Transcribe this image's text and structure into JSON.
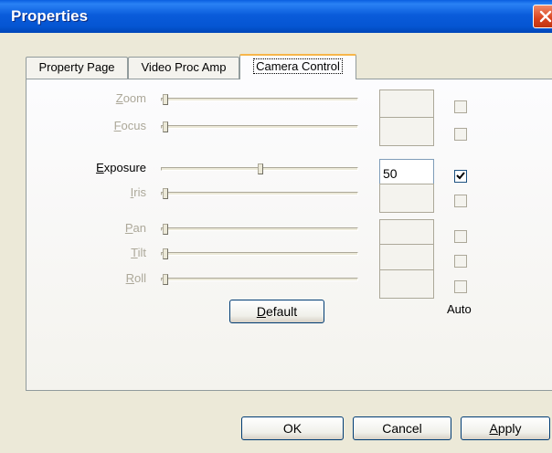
{
  "window": {
    "title": "Properties"
  },
  "tabs": [
    {
      "label": "Property Page",
      "active": false
    },
    {
      "label": "Video Proc Amp",
      "active": false
    },
    {
      "label": "Camera Control",
      "active": true
    }
  ],
  "controls": [
    {
      "label_first": "Z",
      "label_rest": "oom",
      "enabled": false,
      "value": "",
      "level": 0.0,
      "auto": false
    },
    {
      "label_first": "F",
      "label_rest": "ocus",
      "enabled": false,
      "value": "",
      "level": 0.0,
      "auto": false
    },
    {
      "label_first": "E",
      "label_rest": "xposure",
      "enabled": true,
      "value": "50",
      "level": 0.5,
      "auto": true
    },
    {
      "label_first": "I",
      "label_rest": "ris",
      "enabled": false,
      "value": "",
      "level": 0.0,
      "auto": false
    },
    {
      "label_first": "P",
      "label_rest": "an",
      "enabled": false,
      "value": "",
      "level": 0.0,
      "auto": false
    },
    {
      "label_first": "T",
      "label_rest": "ilt",
      "enabled": false,
      "value": "",
      "level": 0.0,
      "auto": false
    },
    {
      "label_first": "R",
      "label_rest": "oll",
      "enabled": false,
      "value": "",
      "level": 0.0,
      "auto": false
    }
  ],
  "panel": {
    "default_first": "D",
    "default_rest": "efault",
    "auto_label": "Auto"
  },
  "footer": {
    "ok_label": "OK",
    "cancel_label": "Cancel",
    "apply_first": "A",
    "apply_rest": "pply"
  },
  "colors": {
    "titlebar": "#0A5CDB",
    "face": "#ECE9D8",
    "disabled_text": "#ACA899",
    "tab_highlight": "#F7B64A"
  }
}
